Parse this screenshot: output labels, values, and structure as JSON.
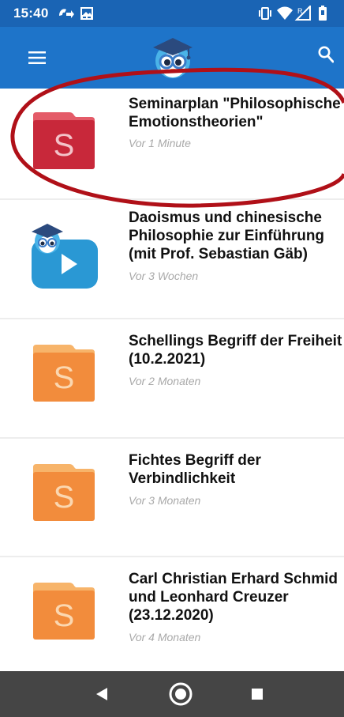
{
  "status_bar": {
    "time": "15:40",
    "left_icons": [
      "call-forwarding-icon",
      "gallery-icon"
    ],
    "right_icons": [
      "vibrate-icon",
      "wifi-icon",
      "signal-icon",
      "battery-icon"
    ]
  },
  "app_bar": {
    "logo": "owl-graduate-logo",
    "menu_icon": "hamburger-menu-icon",
    "search_icon": "search-icon",
    "color": "#1e74c9"
  },
  "items": [
    {
      "title": "Seminarplan \"Philosophische\nEmotionstheorien\"",
      "time": "Vor 1 Minute",
      "thumb": "document-folder",
      "letter": "S",
      "color": "#c8283a"
    },
    {
      "title": "Daoismus und chinesische\nPhilosophie zur Einführung\n(mit Prof. Sebastian Gäb)",
      "time": "Vor 3 Wochen",
      "thumb": "video-owl"
    },
    {
      "title": "Schellings Begriff der Freiheit\n(10.2.2021)",
      "time": "Vor 2 Monaten",
      "thumb": "document-folder",
      "letter": "S",
      "color": "#f28c3c"
    },
    {
      "title": "Fichtes Begriff der\nVerbindlichkeit",
      "time": "Vor 3 Monaten",
      "thumb": "document-folder",
      "letter": "S",
      "color": "#f28c3c"
    },
    {
      "title": "Carl Christian Erhard Schmid\nund Leonhard Creuzer\n(23.12.2020)",
      "time": "Vor 4 Monaten",
      "thumb": "document-folder",
      "letter": "S",
      "color": "#f28c3c"
    }
  ],
  "annotation": {
    "color": "#b01018"
  },
  "nav_bar": {
    "back_icon": "back-triangle-icon",
    "home_icon": "home-circle-icon",
    "recents_icon": "recents-square-icon"
  }
}
